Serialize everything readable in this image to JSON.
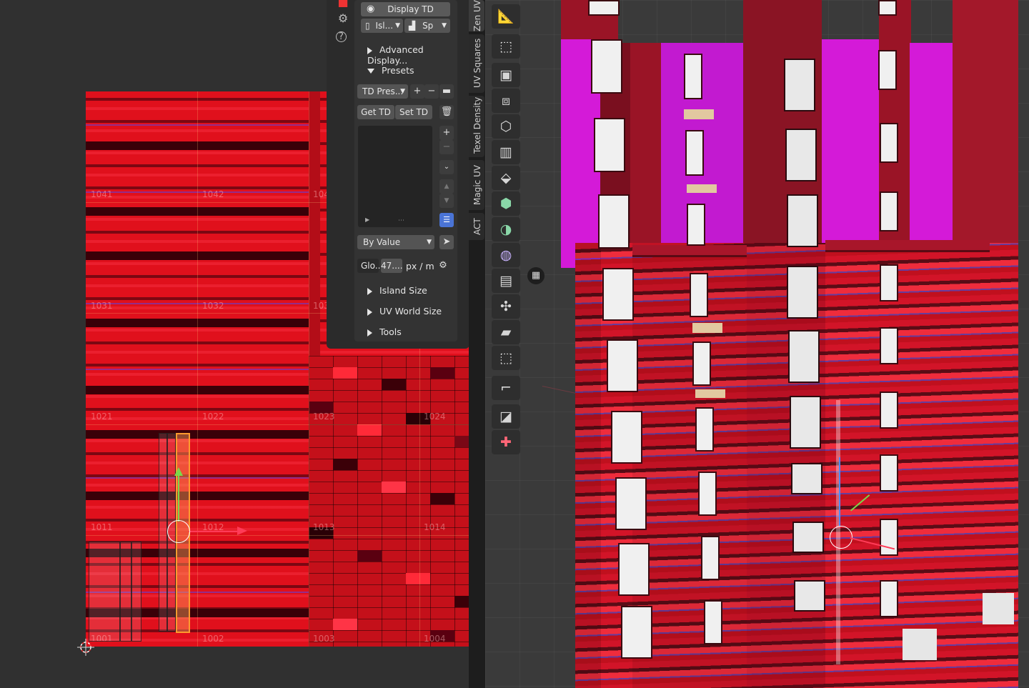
{
  "uv_editor": {
    "tile_labels": [
      "1041",
      "1042",
      "104",
      "1031",
      "1032",
      "103",
      "1021",
      "1022",
      "1023",
      "1024",
      "1011",
      "1012",
      "1013",
      "1014",
      "1001",
      "1002",
      "1003",
      "1004"
    ]
  },
  "panel": {
    "display_td": "Display TD",
    "island_dropdown": "Isl...",
    "spectrum_dropdown": "Sp",
    "advanced_display": "Advanced Display...",
    "presets": "Presets",
    "td_presets": "TD Pres...",
    "get_td": "Get TD",
    "set_td": "Set TD",
    "by_value": "By Value",
    "global_label": "Glo...",
    "global_value": "47....",
    "unit": "px / m",
    "island_size": "Island Size",
    "uv_world_size": "UV World Size",
    "tools": "Tools"
  },
  "tabs": [
    "Zen UV",
    "UV Squares",
    "Texel Density",
    "Magic UV",
    "ACT"
  ],
  "icons": {
    "settings": "gear-icon",
    "help": "help-icon",
    "eye": "eye-icon",
    "add": "plus-icon",
    "remove": "minus-icon",
    "folder": "folder-icon",
    "trash": "trash-icon",
    "list": "list-icon",
    "cursor": "cursor-select-icon"
  },
  "colors": {
    "texel_red": "#e0101c",
    "magenta": "#d41ad8",
    "selection": "#ff9a2e",
    "gizmo_x": "#ff3b57",
    "gizmo_y": "#7bd84a"
  }
}
